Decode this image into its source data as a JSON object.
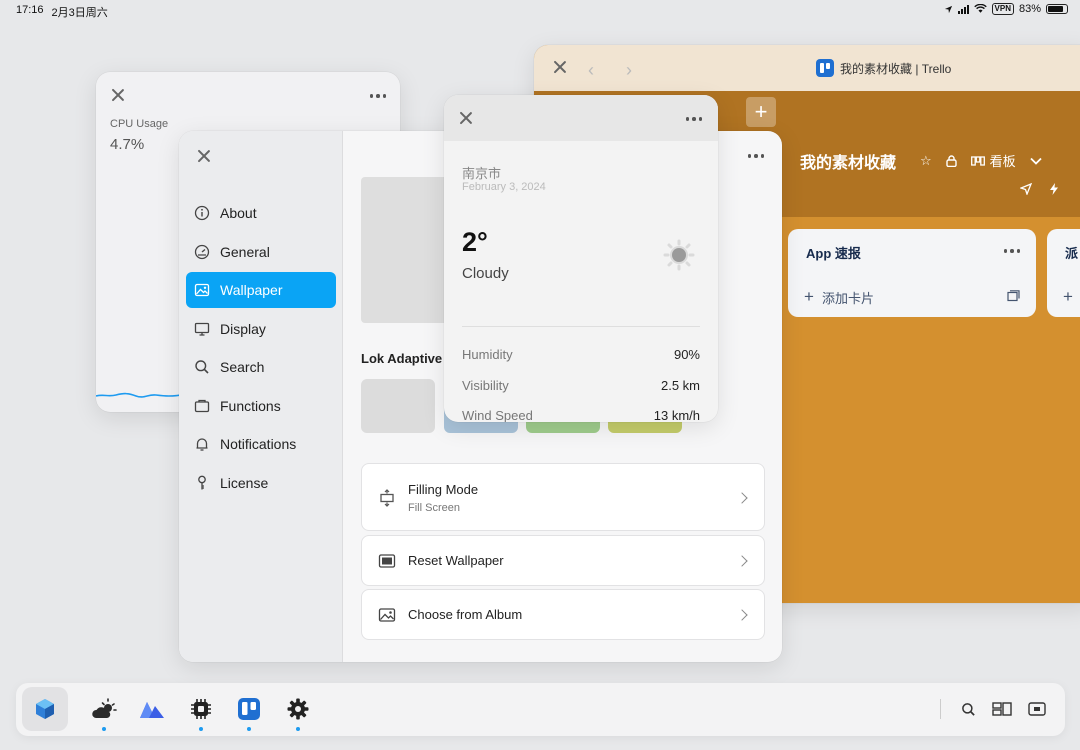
{
  "status_bar": {
    "time": "17:16",
    "date": "2月3日周六",
    "vpn": "VPN",
    "battery": "83%",
    "battery_level": 0.83
  },
  "cpu_widget": {
    "label": "CPU Usage",
    "value": "4.7%",
    "line_color": "#1e9bf0"
  },
  "trello": {
    "window_title": "我的素材收藏 | Trello",
    "board_title": "我的素材收藏",
    "view_label": "看板",
    "lists": [
      {
        "title": "App 速报",
        "add_card": "添加卡片"
      },
      {
        "title": "派"
      }
    ],
    "add_symbol": "+",
    "background_color": "#d4902f"
  },
  "settings": {
    "sidebar_items": [
      {
        "label": "About",
        "icon": "info-icon"
      },
      {
        "label": "General",
        "icon": "gauge-icon"
      },
      {
        "label": "Wallpaper",
        "icon": "image-icon"
      },
      {
        "label": "Display",
        "icon": "monitor-icon"
      },
      {
        "label": "Search",
        "icon": "search-icon"
      },
      {
        "label": "Functions",
        "icon": "folder-icon"
      },
      {
        "label": "Notifications",
        "icon": "bell-icon"
      },
      {
        "label": "License",
        "icon": "key-icon"
      }
    ],
    "active_item": "Wallpaper",
    "accent_color": "#0aa4f5",
    "section_title": "Lok Adaptive",
    "options": [
      {
        "title": "Filling Mode",
        "subtitle": "Fill Screen",
        "icon": "resize-icon"
      },
      {
        "title": "Reset Wallpaper",
        "icon": "screen-icon"
      },
      {
        "title": "Choose from Album",
        "icon": "photo-icon"
      }
    ]
  },
  "weather": {
    "city": "南京市",
    "date": "February 3, 2024",
    "temperature": "2°",
    "condition": "Cloudy",
    "details": [
      {
        "label": "Humidity",
        "value": "90%"
      },
      {
        "label": "Visibility",
        "value": "2.5 km"
      },
      {
        "label": "Wind Speed",
        "value": "13 km/h"
      }
    ]
  },
  "dock": {
    "apps": [
      "lok-app-icon",
      "weather-app-icon",
      "atlas-app-icon",
      "cpu-app-icon",
      "trello-app-icon",
      "settings-app-icon"
    ],
    "right_icons": [
      "search-icon",
      "window-layout-icon",
      "screenshot-icon"
    ]
  }
}
